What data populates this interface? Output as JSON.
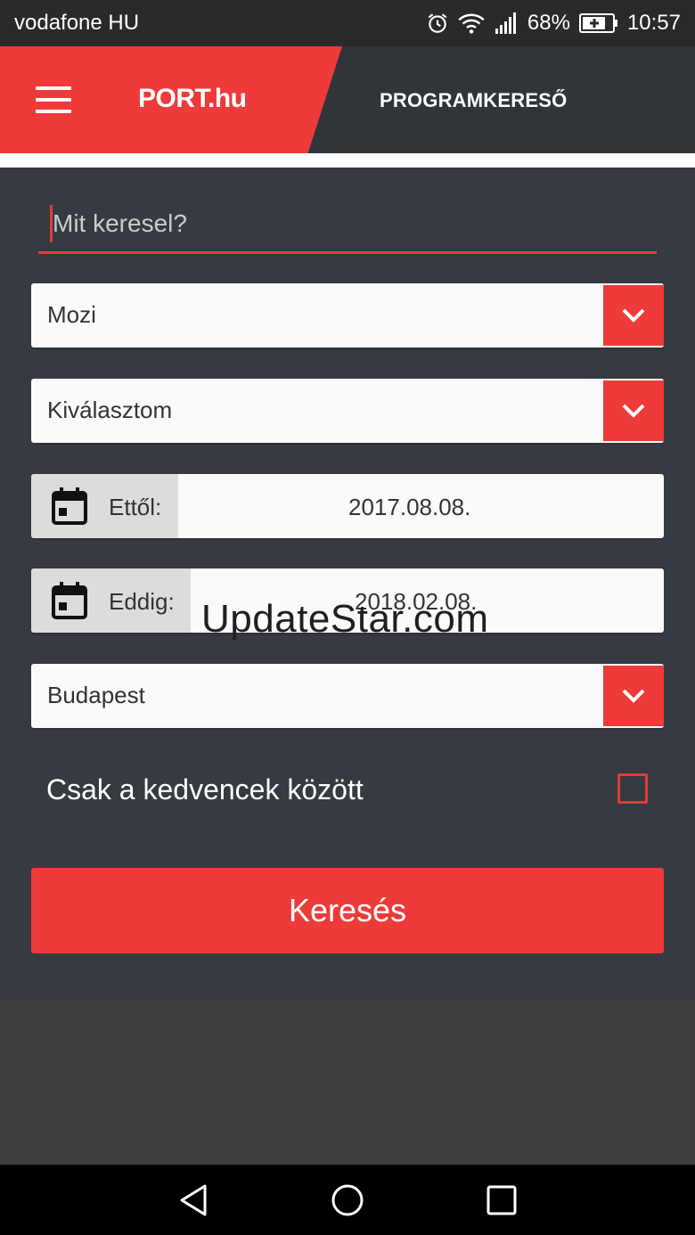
{
  "status_bar": {
    "carrier": "vodafone HU",
    "battery": "68%",
    "time": "10:57"
  },
  "app_bar": {
    "logo": "PORT.hu",
    "title": "PROGRAMKERESŐ"
  },
  "search": {
    "placeholder": "Mit keresel?",
    "value": ""
  },
  "category_select": {
    "value": "Mozi"
  },
  "subcategory_select": {
    "value": "Kiválasztom"
  },
  "date_from": {
    "label": "Ettől:",
    "value": "2017.08.08."
  },
  "date_to": {
    "label": "Eddig:",
    "value": "2018.02.08."
  },
  "city_select": {
    "value": "Budapest"
  },
  "favorites": {
    "label": "Csak a kedvencek között",
    "checked": false
  },
  "submit": {
    "label": "Keresés"
  },
  "watermark": "UpdateStar.com",
  "colors": {
    "accent": "#ef3a3a",
    "app_bar": "#2f3539",
    "form_bg": "#353b40"
  }
}
